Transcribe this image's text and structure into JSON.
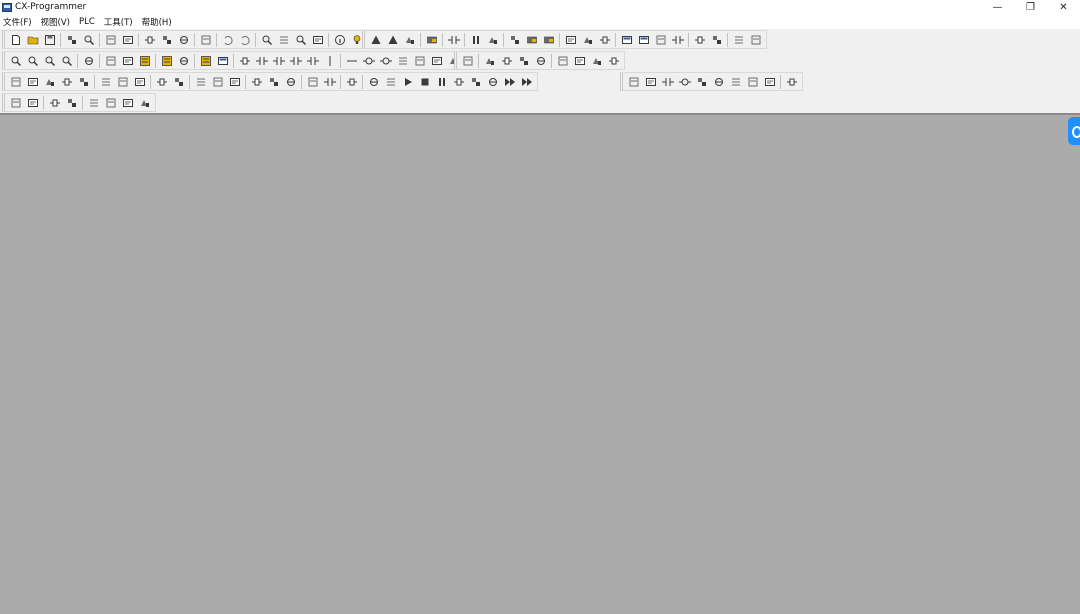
{
  "window": {
    "title": "CX-Programmer",
    "minimize_glyph": "—",
    "restore_glyph": "❐",
    "close_glyph": "✕"
  },
  "menu": [
    "文件(F)",
    "视图(V)",
    "PLC",
    "工具(T)",
    "帮助(H)"
  ],
  "colors": {
    "workspace": "#ababab",
    "toolbar_bg": "#f0f0f0",
    "side_tab_accent": "#1e90ff"
  },
  "toolbars": [
    {
      "row": 1,
      "groups": [
        [
          "new-file-icon",
          "open-folder-icon",
          "save-icon",
          "|",
          "print-preview-icon",
          "zoom-page-icon",
          "|",
          "print-icon",
          "print-setup-icon",
          "|",
          "cut-icon",
          "copy-icon",
          "paste-icon",
          "|",
          "delete-icon",
          "|",
          "undo-icon",
          "redo-icon",
          "|",
          "find-icon",
          "replace-icon",
          "find-address-icon",
          "replace-address-icon",
          "|",
          "info-icon",
          "help-bulb-icon",
          "context-help-icon"
        ],
        [
          "work-online-icon",
          "auto-online-icon",
          "online-settings-icon",
          "|",
          "transfer-icon",
          "|",
          "monitor-icon",
          "|",
          "pause-icon",
          "force-on-icon",
          "|",
          "compare-icon",
          "transfer-to-plc-icon",
          "transfer-from-plc-icon",
          "|",
          "online-edit-icon",
          "send-changes-icon",
          "cancel-edit-icon",
          "|",
          "memory-icon",
          "io-table-icon",
          "settings-icon",
          "error-log-icon",
          "|",
          "cycle-time-icon",
          "clock-icon",
          "|",
          "data-trace-icon",
          "time-chart-icon"
        ]
      ]
    },
    {
      "row": 2,
      "groups": [
        [
          "zoom-in-icon",
          "zoom-fit-icon",
          "zoom-out-icon",
          "zoom-icon",
          "|",
          "grid-icon",
          "|",
          "comment-icon",
          "list-icon",
          "symbol-table-icon",
          "|",
          "ladder-icon",
          "mnemonic-icon",
          "|",
          "show-ladder-icon",
          "show-symbols-icon",
          "|",
          "select-mode-icon",
          "no-contact-icon",
          "nc-contact-icon",
          "or-no-icon",
          "or-nc-icon",
          "vertical-line-icon",
          "|",
          "horizontal-line-icon",
          "coil-icon",
          "nc-coil-icon",
          "instruction-icon",
          "fb-icon",
          "branch-icon",
          "step-icon",
          "output-icon"
        ],
        [
          "sfc-icon",
          "|",
          "program-icon",
          "task-icon",
          "section-icon",
          "end-icon",
          "|",
          "properties-icon",
          "view-window-icon",
          "watch-window-icon",
          "address-ref-icon"
        ]
      ]
    },
    {
      "row": 3,
      "groups": [
        [
          "project-icon",
          "output-window-icon",
          "watch-icon",
          "cross-ref-icon",
          "address-icon",
          "|",
          "properties-panel-icon",
          "compile-icon",
          "check-icon",
          "|",
          "compile-all-icon",
          "binary-icon",
          "|",
          "hex-icon",
          "decimal-icon",
          "text-icon",
          "|",
          "upload-icon",
          "download-icon",
          "verify-icon",
          "|",
          "run-mode-icon",
          "monitor-mode-icon",
          "|",
          "program-mode-icon",
          "|",
          "step-in-icon",
          "step-over-icon",
          "play-icon",
          "stop-icon",
          "pause-sim-icon",
          "step-end-icon",
          "step-out-icon",
          "break-icon",
          "fast-forward-icon",
          "skip-icon"
        ],
        [
          "rung-icon",
          "block-icon",
          "contact-block-icon",
          "coil-block-icon",
          "parallel-icon",
          "series-icon",
          "branch-up-icon",
          "branch-down-icon",
          "merge-icon",
          "|",
          "return-icon"
        ]
      ]
    },
    {
      "row": 4,
      "groups": [
        [
          "indent-icon",
          "outdent-icon",
          "|",
          "align-icon",
          "align-right-icon",
          "|",
          "toggle-bit-icon",
          "set-bit-icon",
          "reset-bit-icon",
          "clear-force-icon"
        ]
      ]
    }
  ]
}
